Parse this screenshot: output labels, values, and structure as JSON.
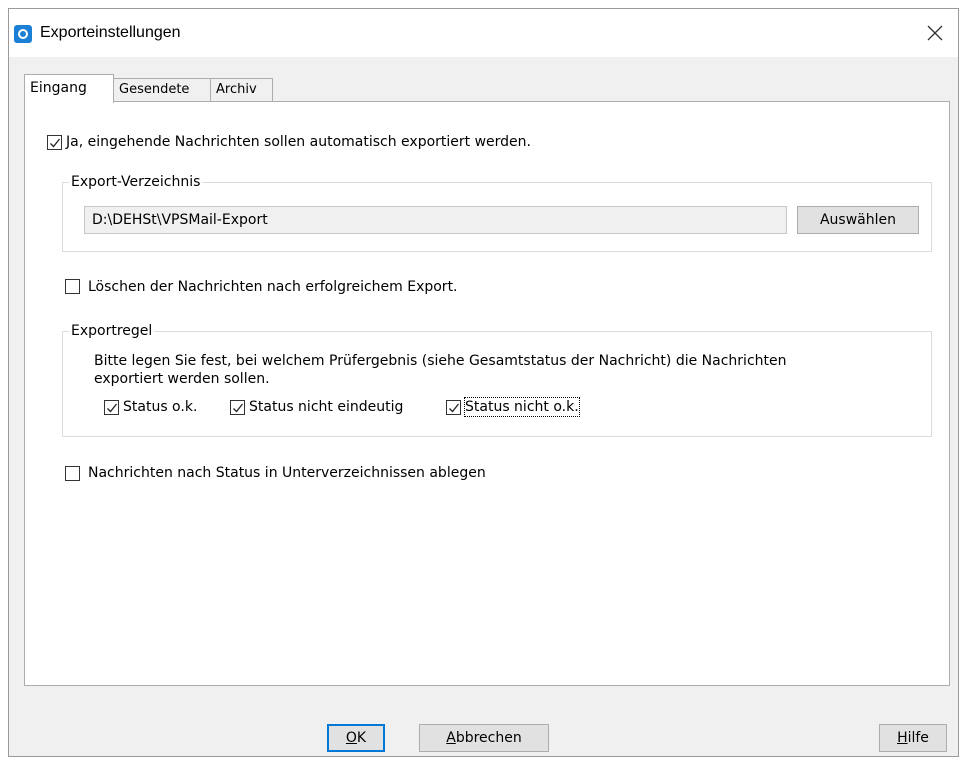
{
  "window": {
    "title": "Exporteinstellungen"
  },
  "tabs": [
    {
      "label": "Eingang",
      "active": true
    },
    {
      "label": "Gesendete",
      "active": false
    },
    {
      "label": "Archiv",
      "active": false
    }
  ],
  "auto_export": {
    "label": "Ja, eingehende Nachrichten sollen automatisch exportiert werden.",
    "checked": true
  },
  "export_dir": {
    "group_title": "Export-Verzeichnis",
    "path": "D:\\DEHSt\\VPSMail-Export",
    "select_button": "Auswählen"
  },
  "delete_after": {
    "label": "Löschen der Nachrichten nach erfolgreichem Export.",
    "checked": false
  },
  "export_rule": {
    "group_title": "Exportregel",
    "description_line1": "Bitte legen Sie fest, bei welchem Prüfergebnis (siehe Gesamtstatus der Nachricht) die Nachrichten",
    "description_line2": "exportiert werden sollen.",
    "status_ok": {
      "label": "Status o.k.",
      "checked": true
    },
    "status_unclear": {
      "label": "Status nicht eindeutig",
      "checked": true
    },
    "status_not_ok": {
      "label": "Status nicht o.k.",
      "checked": true
    }
  },
  "subfolders": {
    "label": "Nachrichten nach Status in Unterverzeichnissen ablegen",
    "checked": false
  },
  "buttons": {
    "ok_mnemonic": "O",
    "ok_rest": "K",
    "cancel_mnemonic": "A",
    "cancel_rest": "bbrechen",
    "help_mnemonic": "H",
    "help_rest": "ilfe"
  },
  "icons": {
    "app": "app-logo-icon",
    "close": "close-icon",
    "check": "checkmark-icon"
  }
}
